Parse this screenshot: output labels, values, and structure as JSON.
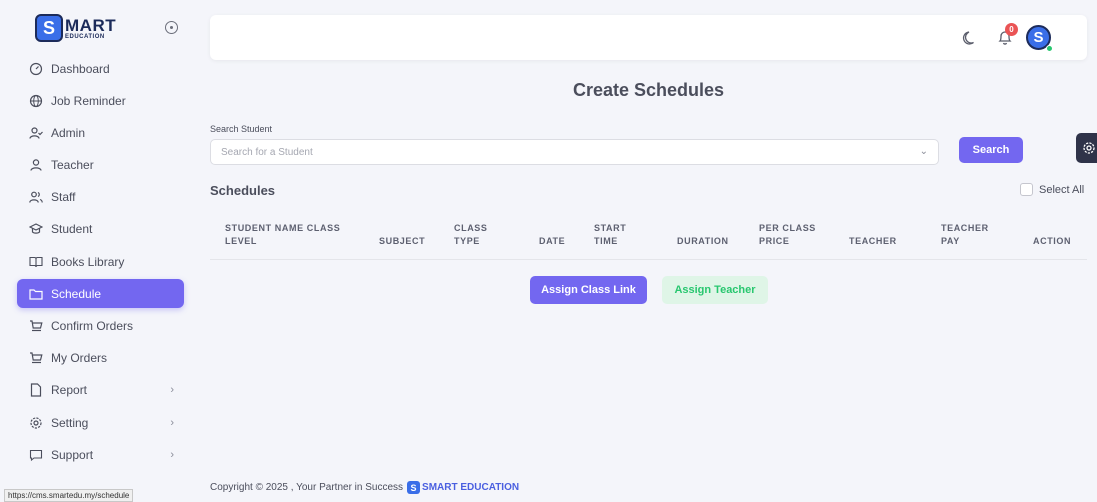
{
  "logo": {
    "letter": "S",
    "big": "MART",
    "small": "EDUCATION"
  },
  "sidebar": {
    "items": [
      {
        "label": "Dashboard",
        "icon": "dashboard-icon"
      },
      {
        "label": "Job Reminder",
        "icon": "globe-icon"
      },
      {
        "label": "Admin",
        "icon": "user-check-icon"
      },
      {
        "label": "Teacher",
        "icon": "user-icon"
      },
      {
        "label": "Staff",
        "icon": "users-icon"
      },
      {
        "label": "Student",
        "icon": "graduation-cap-icon"
      },
      {
        "label": "Books Library",
        "icon": "book-icon"
      },
      {
        "label": "Schedule",
        "icon": "folder-icon",
        "active": true
      },
      {
        "label": "Confirm Orders",
        "icon": "cart-icon"
      },
      {
        "label": "My Orders",
        "icon": "cart-icon"
      },
      {
        "label": "Report",
        "icon": "file-icon",
        "chevron": true
      },
      {
        "label": "Setting",
        "icon": "gear-icon",
        "chevron": true
      },
      {
        "label": "Support",
        "icon": "chat-icon",
        "chevron": true
      }
    ]
  },
  "status_url": "https://cms.smartedu.my/schedule",
  "topbar": {
    "notification_count": "0",
    "avatar_letter": "S"
  },
  "page": {
    "title": "Create Schedules",
    "search_label": "Search Student",
    "search_placeholder": "Search for a Student",
    "search_button": "Search",
    "section_title": "Schedules",
    "select_all": "Select All"
  },
  "table": {
    "columns": [
      "STUDENT NAME CLASS LEVEL",
      "SUBJECT",
      "CLASS TYPE",
      "DATE",
      "START TIME",
      "DURATION",
      "PER CLASS PRICE",
      "TEACHER",
      "TEACHER PAY",
      "ACTION"
    ]
  },
  "actions": {
    "assign_class_link": "Assign Class Link",
    "assign_teacher": "Assign Teacher"
  },
  "footer": {
    "text": "Copyright © 2025 , Your Partner in Success",
    "brand_letter": "S",
    "brand": "SMART EDUCATION"
  },
  "colors": {
    "accent": "#7367f0",
    "success": "#28c76f",
    "danger": "#ea5455",
    "brand_blue": "#3a6ee8"
  }
}
